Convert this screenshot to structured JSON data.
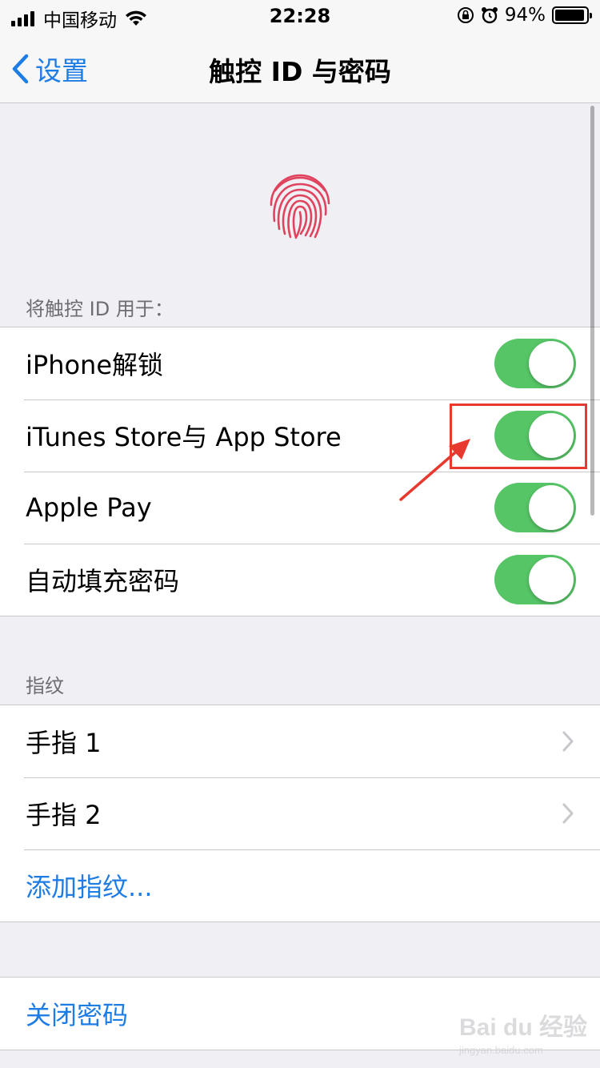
{
  "status_bar": {
    "carrier": "中国移动",
    "time": "22:28",
    "battery_percent": "94%",
    "battery_level": 0.94
  },
  "nav": {
    "back_label": "设置",
    "title": "触控 ID 与密码"
  },
  "use_for": {
    "header": "将触控 ID 用于：",
    "items": [
      {
        "label": "iPhone解锁",
        "on": true
      },
      {
        "label": "iTunes Store与 App Store",
        "on": true
      },
      {
        "label": "Apple Pay",
        "on": true
      },
      {
        "label": "自动填充密码",
        "on": true
      }
    ]
  },
  "fingerprints": {
    "header": "指纹",
    "items": [
      {
        "label": "手指 1"
      },
      {
        "label": "手指 2"
      }
    ],
    "add_label": "添加指纹..."
  },
  "passcode": {
    "turn_off_label": "关闭密码"
  },
  "colors": {
    "accent": "#1e7de5",
    "toggle_on": "#56c566",
    "annotation": "#e8392f",
    "fingerprint": "#e0435e"
  },
  "watermark": {
    "logo": "Bai du 经验",
    "sub": "jingyan.baidu.com"
  }
}
